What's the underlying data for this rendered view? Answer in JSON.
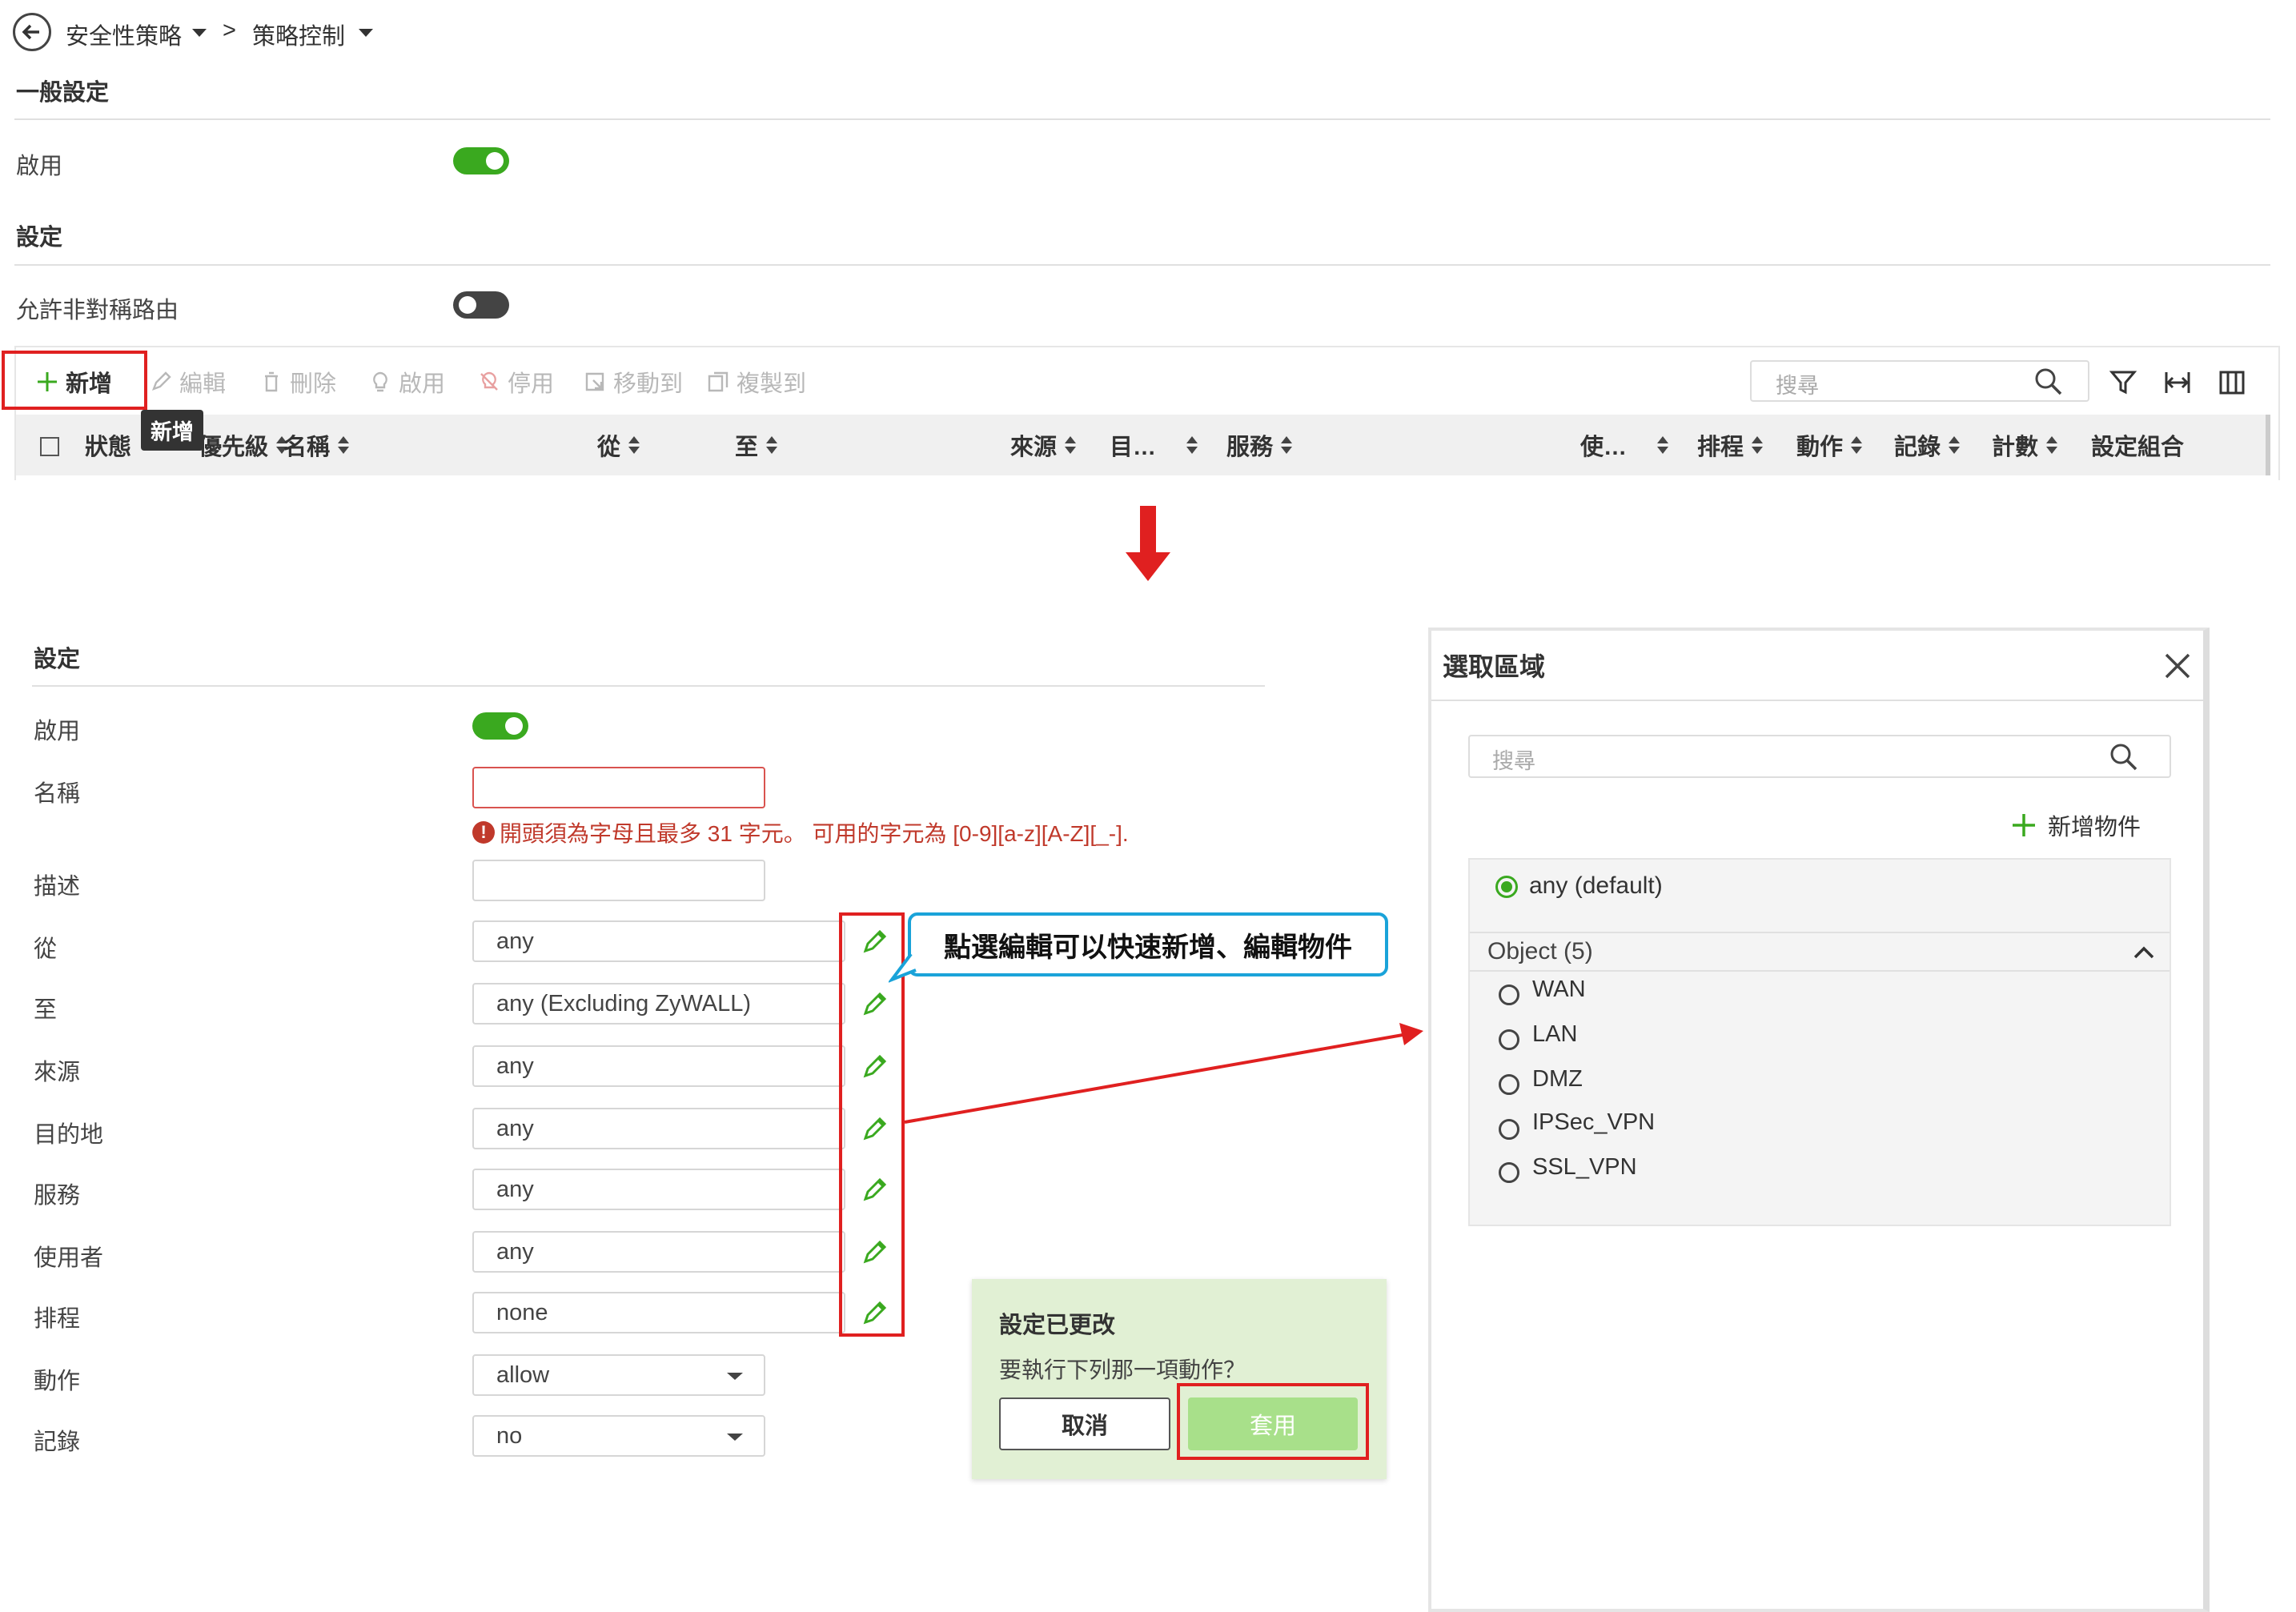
{
  "top": {
    "breadcrumb": {
      "item1": "安全性策略",
      "sep": ">",
      "item2": "策略控制"
    },
    "general_settings": "一般設定",
    "enable_label": "啟用",
    "settings": "設定",
    "asym_label": "允許非對稱路由",
    "toolbar": {
      "add": "新增",
      "edit": "編輯",
      "delete": "刪除",
      "enable": "啟用",
      "disable": "停用",
      "move_to": "移動到",
      "copy_to": "複製到",
      "search_placeholder": "搜尋"
    },
    "tooltip": "新增",
    "columns": [
      "狀態",
      "優先級",
      "名稱",
      "從",
      "至",
      "來源",
      "目…",
      "服務",
      "使…",
      "排程",
      "動作",
      "記錄",
      "計數",
      "設定組合"
    ]
  },
  "form": {
    "section": "設定",
    "enable": "啟用",
    "name": "名稱",
    "name_error": "開頭須為字母且最多 31 字元。 可用的字元為 [0-9][a-z][A-Z][_-].",
    "description": "描述",
    "from": "從",
    "from_value": "any",
    "to": "至",
    "to_value": "any (Excluding ZyWALL)",
    "source": "來源",
    "source_value": "any",
    "destination": "目的地",
    "destination_value": "any",
    "service": "服務",
    "service_value": "any",
    "user": "使用者",
    "user_value": "any",
    "schedule": "排程",
    "schedule_value": "none",
    "action": "動作",
    "action_value": "allow",
    "log": "記錄",
    "log_value": "no"
  },
  "callout": "點選編輯可以快速新增、編輯物件",
  "changed_panel": {
    "title": "設定已更改",
    "question": "要執行下列那一項動作？",
    "cancel": "取消",
    "apply": "套用"
  },
  "zone_dialog": {
    "title": "選取區域",
    "search_placeholder": "搜尋",
    "add_object": "新增物件",
    "default_option": "any (default)",
    "group_label": "Object (5)",
    "options": [
      "WAN",
      "LAN",
      "DMZ",
      "IPSec_VPN",
      "SSL_VPN"
    ]
  },
  "colors": {
    "accent_green": "#3aa91f",
    "highlight_red": "#e02020",
    "callout_blue": "#1aa3d9",
    "error_red": "#c0392b"
  }
}
